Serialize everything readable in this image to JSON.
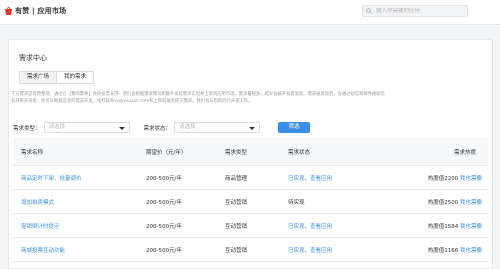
{
  "header": {
    "brand_name": "有赞 | 应用市场",
    "search_placeholder": "输入你需要的应用"
  },
  "page": {
    "title": "需求中心",
    "tabs": [
      {
        "label": "需求广场",
        "active": true
      },
      {
        "label": "我的需求",
        "active": false
      }
    ],
    "description_line1": "下方需求是有赞整理、通过在【我的需要】共同投票支持、我们会根据需求情况和额外发起需求实现并上架到应用市场。需求量越多、越早会被开发者发现。需求被发现后，会通过短信和邮件通知您",
    "description_line2": "有开发开发者，你可以根据这里的需求开发，或打联系sv@youzan.com和上架的服务提交需求。我们会与您的的行开发工作。"
  },
  "filters": {
    "type_label": "需求类型：",
    "type_placeholder": "请选择",
    "status_label": "需求状态：",
    "status_placeholder": "请选择",
    "button_label": "筛选"
  },
  "table": {
    "headers": [
      "需求名称",
      "期望价（元/年）",
      "需求类型",
      "需求状态",
      "需求热度"
    ],
    "rows": [
      {
        "name": "商品定时下架、批量调价",
        "price": "200-500元/年",
        "type": "商品管理",
        "status": "已实现，查看应用",
        "heat": "热度值2200",
        "action": "我也需要"
      },
      {
        "name": "增加拍卖模式",
        "price": "200-500元/年",
        "type": "互动营销",
        "status": "待实现",
        "heat": "热度值2500",
        "action": "我也需要"
      },
      {
        "name": "促销倒计时提示",
        "price": "200-500元/年",
        "type": "互动营销",
        "status": "已实现，查看应用",
        "heat": "热度值1584",
        "action": "我也需要"
      },
      {
        "name": "商城投票互动功能",
        "price": "200-500元/年",
        "type": "互动营销",
        "status": "已实现，查看应用",
        "heat": "热度值1166",
        "action": "我也需要"
      }
    ]
  },
  "colors": {
    "accent": "#3a8ee6",
    "brand": "#e03b2f"
  }
}
